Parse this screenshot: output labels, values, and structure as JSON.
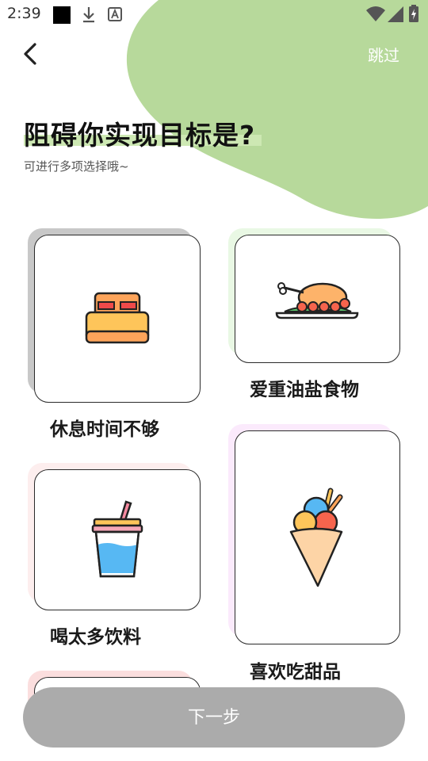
{
  "status_bar": {
    "time": "2:39",
    "icons": [
      "notification-square-icon",
      "download-icon",
      "font-a-icon",
      "wifi-icon",
      "signal-icon",
      "battery-charging-icon"
    ]
  },
  "header": {
    "back_icon": "chevron-left-icon",
    "skip_label": "跳过"
  },
  "title": "阻碍你实现目标是?",
  "subtitle": "可进行多项选择哦~",
  "options": [
    {
      "label": "休息时间不够",
      "icon": "bed-icon",
      "shadow_color": "#c8c8c8",
      "selected": true
    },
    {
      "label": "爱重油盐食物",
      "icon": "roast-chicken-icon",
      "shadow_color": "#e9f8e4",
      "selected": false
    },
    {
      "label": "喝太多饮料",
      "icon": "drink-cup-icon",
      "shadow_color": "#fdeeee",
      "selected": false
    },
    {
      "label": "喜欢吃甜品",
      "icon": "ice-cream-icon",
      "shadow_color": "#fbeafc",
      "selected": false
    },
    {
      "label": "",
      "icon": "",
      "shadow_color": "#fbdede",
      "selected": false
    }
  ],
  "next_button": "下一步",
  "colors": {
    "accent_green": "#b7d99b",
    "button_disabled": "#ababab",
    "highlight": "#cde8b3"
  }
}
